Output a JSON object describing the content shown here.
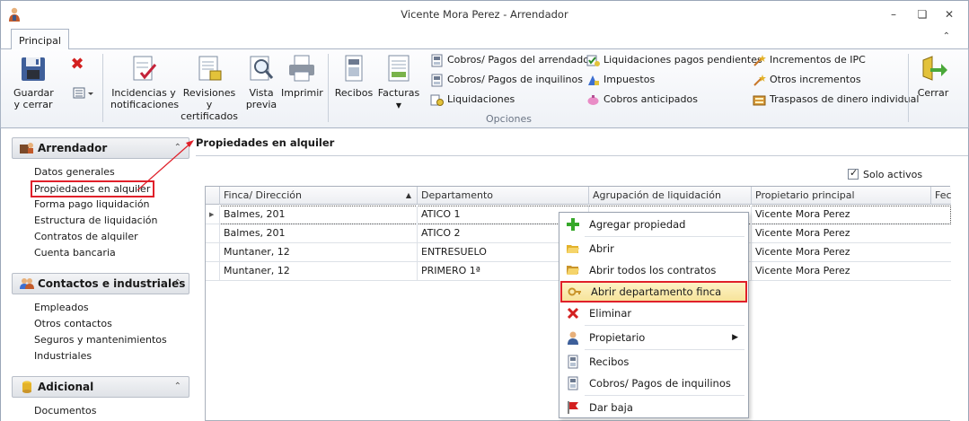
{
  "window": {
    "title": "Vicente Mora Perez - Arrendador"
  },
  "tabs": [
    {
      "label": "Principal"
    }
  ],
  "ribbon": {
    "save_label_1": "Guardar",
    "save_label_2": "y cerrar",
    "incidencias_1": "Incidencias y",
    "incidencias_2": "notificaciones",
    "revisiones_1": "Revisiones y",
    "revisiones_2": "certificados",
    "vista_1": "Vista",
    "vista_2": "previa",
    "imprimir": "Imprimir",
    "recibos": "Recibos",
    "facturas": "Facturas",
    "close_label": "Cerrar",
    "small_col1": [
      "Cobros/ Pagos del arrendador",
      "Cobros/ Pagos de inquilinos",
      "Liquidaciones"
    ],
    "small_col2": [
      "Liquidaciones pagos pendientes",
      "Impuestos",
      "Cobros anticipados"
    ],
    "small_col3": [
      "Incrementos de IPC",
      "Otros incrementos",
      "Traspasos de dinero individual"
    ],
    "group_label": "Opciones"
  },
  "sidebar": {
    "arrendador": {
      "title": "Arrendador",
      "items": [
        "Datos generales",
        "Propiedades en alquiler",
        "Forma pago liquidación",
        "Estructura de liquidación",
        "Contratos de alquiler",
        "Cuenta bancaria"
      ]
    },
    "contactos": {
      "title": "Contactos e industriales",
      "items": [
        "Empleados",
        "Otros contactos",
        "Seguros y mantenimientos",
        "Industriales"
      ]
    },
    "adicional": {
      "title": "Adicional",
      "items": [
        "Documentos"
      ]
    }
  },
  "main": {
    "title": "Propiedades en alquiler",
    "solo_activos": "Solo activos",
    "columns": [
      "Finca/ Dirección",
      "Departamento",
      "Agrupación de liquidación",
      "Propietario principal",
      "Fec"
    ],
    "rows": [
      [
        "Balmes, 201",
        "ATICO 1",
        "",
        "Vicente Mora Perez"
      ],
      [
        "Balmes, 201",
        "ATICO 2",
        "",
        "Vicente Mora Perez"
      ],
      [
        "Muntaner, 12",
        "ENTRESUELO",
        "",
        "Vicente Mora Perez"
      ],
      [
        "Muntaner, 12",
        "PRIMERO 1ª",
        "",
        "Vicente Mora Perez"
      ]
    ]
  },
  "context_menu": {
    "items": [
      "Agregar propiedad",
      "Abrir",
      "Abrir todos los contratos",
      "Abrir departamento finca",
      "Eliminar",
      "Propietario",
      "Recibos",
      "Cobros/ Pagos de inquilinos",
      "Dar baja"
    ],
    "active_index": 3
  },
  "colors": {
    "highlight_border": "#e0202a",
    "menu_hover": "#f7e39a"
  }
}
